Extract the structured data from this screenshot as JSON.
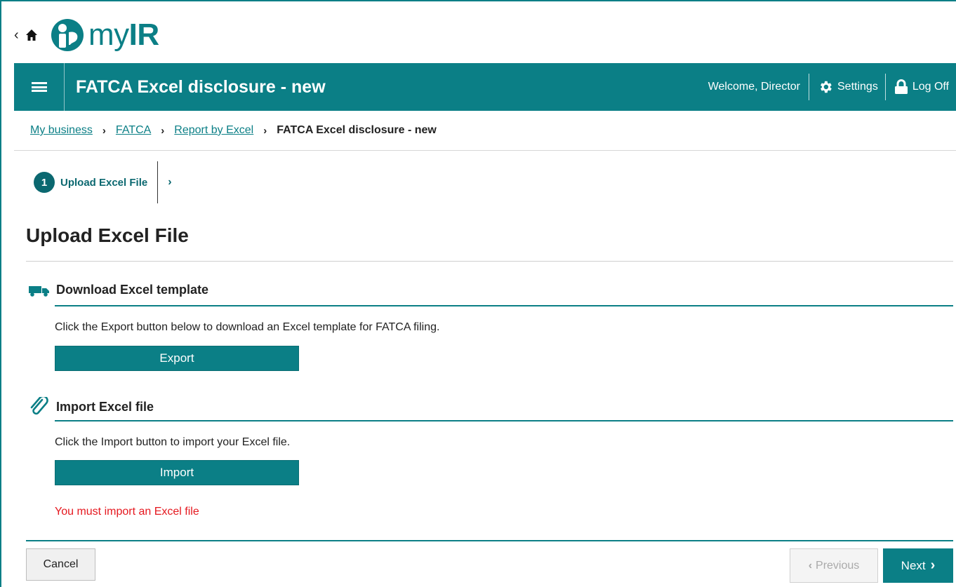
{
  "logo": {
    "prefix": "my",
    "suffix": "IR"
  },
  "header": {
    "title": "FATCA Excel disclosure - new",
    "welcome": "Welcome, Director",
    "settings_label": "Settings",
    "logoff_label": "Log Off"
  },
  "breadcrumb": {
    "items": [
      "My business",
      "FATCA",
      "Report by Excel"
    ],
    "current": "FATCA Excel disclosure - new"
  },
  "stepper": {
    "number": "1",
    "label": "Upload Excel File"
  },
  "page_title": "Upload Excel File",
  "download_section": {
    "heading": "Download Excel template",
    "text": "Click the Export button below to download an Excel template for FATCA filing.",
    "button": "Export"
  },
  "import_section": {
    "heading": "Import Excel file",
    "text": "Click the Import button to import your Excel file.",
    "button": "Import",
    "error": "You must import an Excel file"
  },
  "footer": {
    "cancel": "Cancel",
    "previous": "Previous",
    "next": "Next"
  },
  "colors": {
    "brand": "#0b7f86",
    "error": "#e5181f"
  }
}
